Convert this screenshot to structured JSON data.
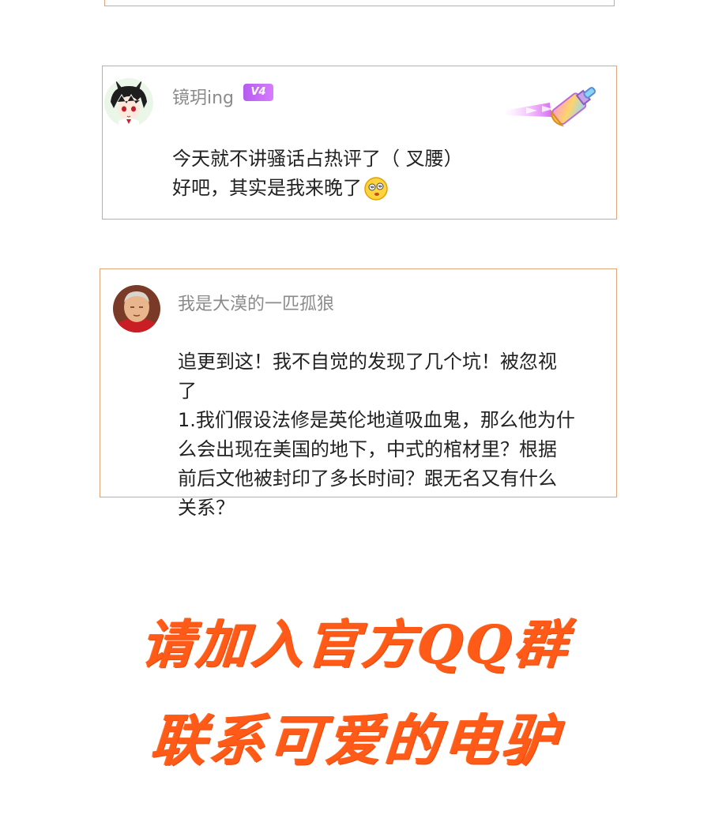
{
  "comments": [
    {
      "username": "镜玥ing",
      "badge": "V4",
      "text_line1": "今天就不讲骚话占热评了（ 叉腰）",
      "text_line2": "好吧，其实是我来晚了",
      "emoji": "dizzy-face-emoji",
      "decoration": "paintbrush-decoration",
      "avatar": "anime-boy-bunny-ears-avatar"
    },
    {
      "username": "我是大漠的一匹孤狼",
      "text": "追更到这！我不自觉的发现了几个坑！被忽视\n了\n1.我们假设法修是英伦地道吸血鬼，那么他为什\n么会出现在美国的地下，中式的棺材里？根据\n前后文他被封印了多长时间？跟无名又有什么\n关系？",
      "avatar": "elderly-man-red-avatar"
    }
  ],
  "promo": {
    "line1": "请加入官方QQ群",
    "line2": "联系可爱的电驴"
  },
  "colors": {
    "card_border": "#e0a57a",
    "promo_text": "#ff5a18",
    "vip_badge": "#c56cf5",
    "username": "#8b8b8b"
  }
}
